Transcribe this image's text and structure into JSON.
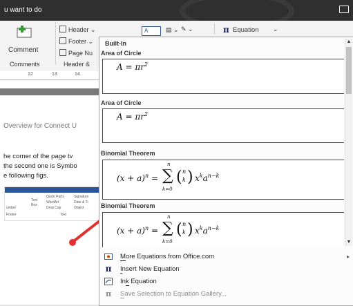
{
  "titlebar": {
    "tell_me": "u want to do"
  },
  "ribbon": {
    "comment_label": "Comment",
    "comments_group": "Comments",
    "header_btn": "Header",
    "footer_btn": "Footer",
    "page_number_btn": "Page Nu",
    "header_footer_group": "Header &",
    "equation_btn": "Equation",
    "ruler": [
      "12",
      "13",
      "14"
    ]
  },
  "document": {
    "heading": "Overview for Connect U",
    "lines": [
      "he corner of the page tv",
      "the second one is Symbo",
      "e following figs."
    ],
    "mini_labels": [
      "Quick Parts",
      "Signature",
      "WordArt",
      "Date & Ti",
      "Drop Cap",
      "Object",
      "Text",
      "Box",
      "Text",
      "umber",
      "Footer"
    ]
  },
  "dropdown": {
    "header": "Built-In",
    "sections": [
      {
        "title": "Area of Circle",
        "equation": "A = πr²"
      },
      {
        "title": "Area of Circle",
        "equation": "A = πr²"
      },
      {
        "title": "Binomial Theorem",
        "equation": "(x + a)ⁿ = Σ (n k) xᵏ aⁿ⁻ᵏ"
      },
      {
        "title": "Binomial Theorem",
        "equation": "(x + a)ⁿ = Σ (n k) xᵏ aⁿ⁻ᵏ"
      }
    ],
    "binomial": {
      "lhs": "(x + a)",
      "lhs_exp": "n",
      "eq": "=",
      "sum": "∑",
      "upper": "n",
      "lower": "k=0",
      "binom_top": "n",
      "binom_bot": "k",
      "x_term": "x",
      "x_exp": "k",
      "a_term": "a",
      "a_exp": "n−k"
    },
    "menu": [
      {
        "label": "More Equations from Office.com",
        "accel": "M",
        "icon": "office-web-icon",
        "submenu": true,
        "disabled": false
      },
      {
        "label": "Insert New Equation",
        "accel": "I",
        "icon": "pi-icon",
        "submenu": false,
        "disabled": false
      },
      {
        "label": "Ink Equation",
        "accel": "k",
        "icon": "ink-icon",
        "submenu": false,
        "disabled": false
      },
      {
        "label": "Save Selection to Equation Gallery...",
        "accel": "S",
        "icon": "save-gallery-icon",
        "submenu": false,
        "disabled": true
      }
    ]
  },
  "colors": {
    "titlebar": "#2f2f2f",
    "accent": "#2b579a",
    "arrow": "#e03030"
  }
}
